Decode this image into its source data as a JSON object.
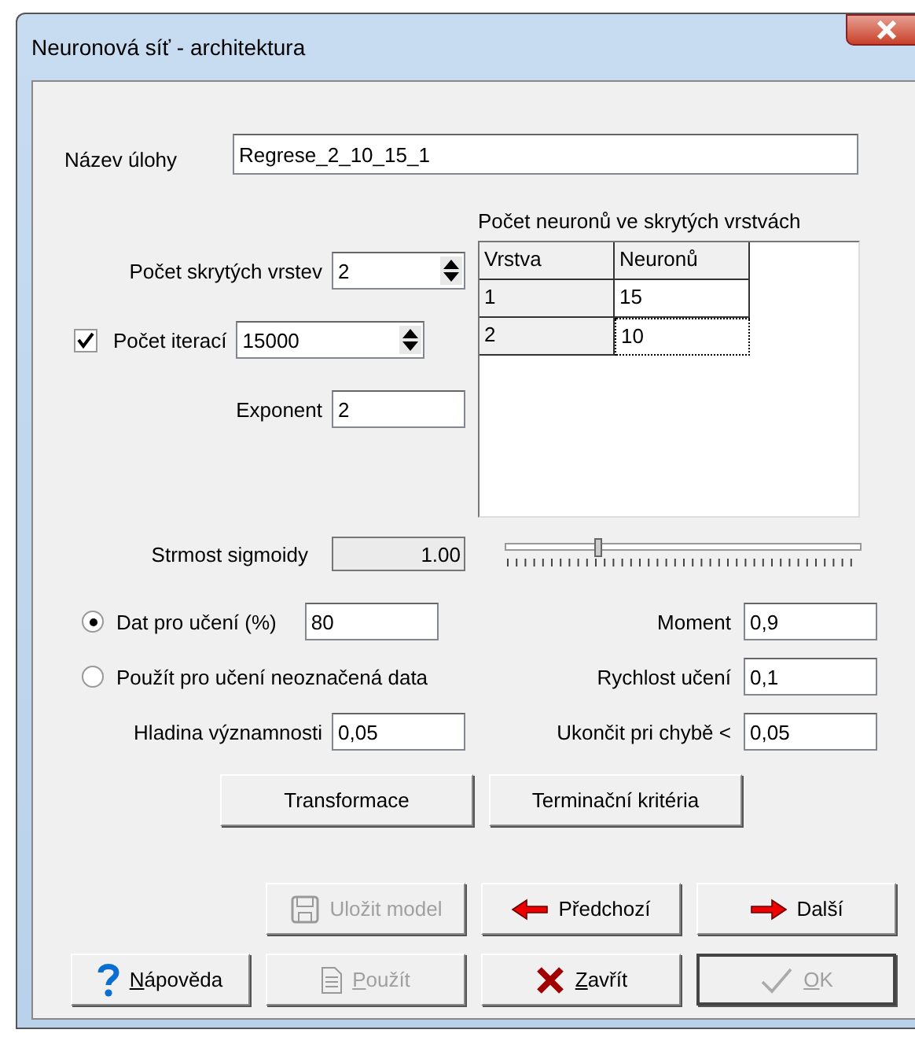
{
  "window": {
    "title": "Neuronová síť - architektura"
  },
  "task_name": {
    "label": "Název úlohy",
    "value": "Regrese_2_10_15_1"
  },
  "hidden_layers": {
    "label": "Počet skrytých vrstev",
    "value": "2"
  },
  "iterations": {
    "label": "Počet iterací",
    "checked": true,
    "value": "15000"
  },
  "exponent": {
    "label": "Exponent",
    "value": "2"
  },
  "layer_table": {
    "title": "Počet neuronů ve skrytých vrstvách",
    "columns": [
      "Vrstva",
      "Neuronů"
    ],
    "rows": [
      {
        "cells": [
          "1",
          "15"
        ],
        "focused": false
      },
      {
        "cells": [
          "2",
          "10"
        ],
        "focused": true
      }
    ]
  },
  "sigmoid": {
    "label": "Strmost sigmoidy",
    "value": "1.00",
    "level": 0.26
  },
  "data_options": [
    {
      "label": "Dat pro učení (%)",
      "selected": true,
      "value": "80"
    },
    {
      "label": "Použít pro učení neoznačená data",
      "selected": false
    }
  ],
  "significance": {
    "label": "Hladina významnosti",
    "value": "0,05"
  },
  "params": [
    {
      "label": "Moment",
      "value": "0,9"
    },
    {
      "label": "Rychlost učení",
      "value": "0,1"
    },
    {
      "label": "Ukončit pri chybě <",
      "value": "0,05"
    }
  ],
  "action_buttons": [
    "Transformace",
    "Terminační kritéria"
  ],
  "button_rows": [
    [
      {
        "label": "Uložit model",
        "kind": "floppy",
        "disabled": true,
        "underline_first": false,
        "default": false
      },
      {
        "label": "Předchozí",
        "kind": "back",
        "disabled": false,
        "underline_first": false,
        "default": false
      },
      {
        "label": "Další",
        "kind": "next",
        "disabled": false,
        "underline_first": false,
        "default": false
      }
    ],
    [
      {
        "label": "Nápověda",
        "kind": "help",
        "disabled": false,
        "underline_first": true,
        "default": false
      },
      {
        "label": "Použít",
        "kind": "document",
        "disabled": true,
        "underline_first": true,
        "default": false
      },
      {
        "label": "Zavřít",
        "kind": "close",
        "disabled": false,
        "underline_first": true,
        "default": false
      },
      {
        "label": "OK",
        "kind": "confirm",
        "disabled": true,
        "underline_first": true,
        "default": true
      }
    ]
  ]
}
